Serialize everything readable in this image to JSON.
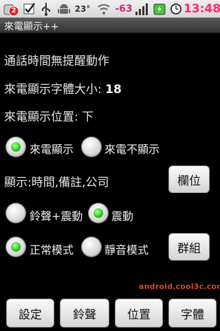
{
  "status_bar": {
    "notification_badge": "2",
    "temperature": "23°",
    "signal_value": "-63",
    "time": "13:48",
    "icons": [
      "app-notification-icon",
      "checkbox-icon",
      "usb-icon",
      "android-icon",
      "wifi-icon",
      "signal-bars-icon",
      "battery-charging-icon",
      "clock-icon"
    ]
  },
  "title_bar": {
    "title": "來電顯示++"
  },
  "settings": {
    "reminder_text": "通話時間無提醒動作",
    "font_size_label": "來電顯示字體大小:",
    "font_size_value": "18",
    "position_label": "來電顯示位置:",
    "position_value": "下"
  },
  "display_group": {
    "show_label": "來電顯示",
    "hide_label": "來電不顯示",
    "selected": "show"
  },
  "fields": {
    "text": "顯示:時間,備註,公司",
    "button_label": "欄位"
  },
  "alert_group": {
    "ring_vibrate_label": "鈴聲+震動",
    "vibrate_label": "震動",
    "selected": "vibrate"
  },
  "mode_group": {
    "normal_label": "正常模式",
    "silent_label": "靜音模式",
    "selected": "normal",
    "group_button_label": "群組"
  },
  "watermark": "android.cool3c.com",
  "bottom_buttons": {
    "settings": "設定",
    "ringtone": "鈴聲",
    "position": "位置",
    "font": "字體"
  },
  "colors": {
    "background": "#000000",
    "selected_radio": "#22c81e",
    "time": "#ff2b6f"
  }
}
